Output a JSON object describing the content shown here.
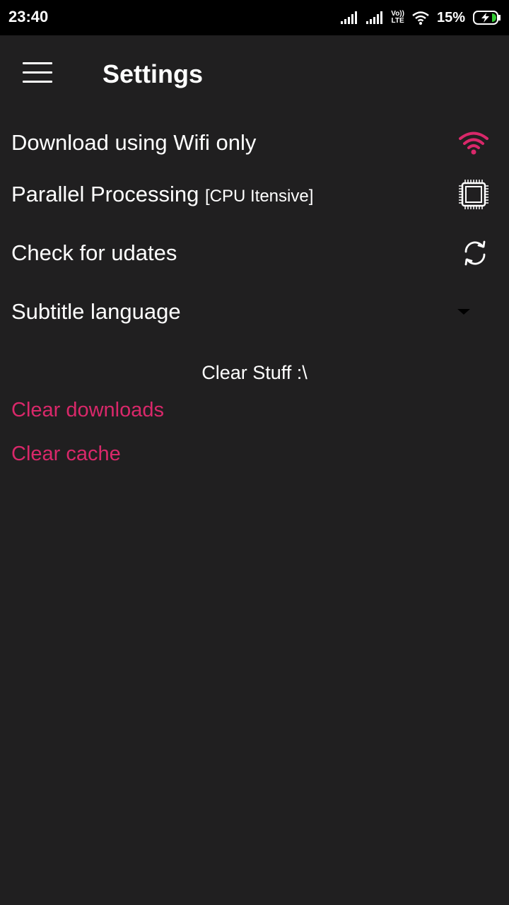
{
  "status_bar": {
    "time": "23:40",
    "network_badge_top": "Vo))",
    "network_badge_bottom": "LTE",
    "battery_percent": "15%",
    "icons": [
      "signal-bars-icon",
      "signal-bars-icon",
      "volte-icon",
      "wifi-icon",
      "battery-charging-icon"
    ]
  },
  "toolbar": {
    "title": "Settings",
    "menu_icon": "hamburger-menu-icon"
  },
  "settings": {
    "wifi_only": {
      "label": "Download using Wifi only",
      "icon": "wifi-icon",
      "icon_color": "#d9286a"
    },
    "parallel": {
      "label": "Parallel Processing",
      "sublabel": "[CPU Itensive]",
      "icon": "cpu-chip-icon"
    },
    "updates": {
      "label": "Check for udates",
      "icon": "sync-icon"
    },
    "subtitle": {
      "label": "Subtitle language",
      "icon": "dropdown-arrow-icon"
    }
  },
  "clear_section": {
    "title": "Clear Stuff :\\",
    "clear_downloads": "Clear downloads",
    "clear_cache": "Clear cache",
    "accent_color": "#d9286a"
  }
}
